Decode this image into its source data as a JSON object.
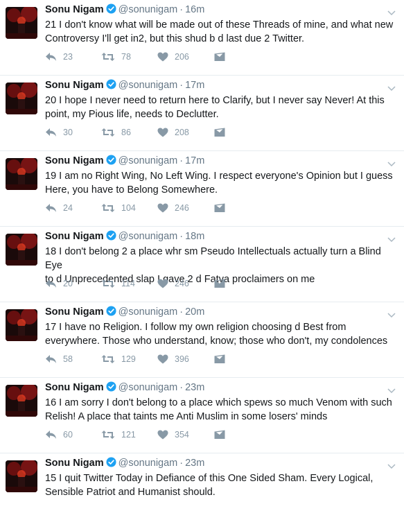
{
  "tweets": [
    {
      "name": "Sonu Nigam",
      "handle": "@sonunigam",
      "time": "16m",
      "line1": "21 I don't know what will be made out of these Threads of mine, and what new",
      "line2": "Controversy I'll get in2, but this shud b d last due 2 Twitter.",
      "replies": "23",
      "retweets": "78",
      "likes": "206"
    },
    {
      "name": "Sonu Nigam",
      "handle": "@sonunigam",
      "time": "17m",
      "line1": "20 I hope I never need to return here to Clarify, but I never say Never! At this",
      "line2": "point, my Pious life, needs to Declutter.",
      "replies": "30",
      "retweets": "86",
      "likes": "208"
    },
    {
      "name": "Sonu Nigam",
      "handle": "@sonunigam",
      "time": "17m",
      "line1": "19 I am no Right Wing, No Left Wing. I respect everyone's Opinion but I guess",
      "line2": "Here, you have to Belong Somewhere.",
      "replies": "24",
      "retweets": "104",
      "likes": "246"
    },
    {
      "name": "Sonu Nigam",
      "handle": "@sonunigam",
      "time": "18m",
      "line1": "18 I don't belong 2 a place whr sm Pseudo Intellectuals actually turn a Blind Eye",
      "line2": "to d Unprecedented slap I gave 2 d Fatva proclaimers on me",
      "replies": "20",
      "retweets": "114",
      "likes": "246"
    },
    {
      "name": "Sonu Nigam",
      "handle": "@sonunigam",
      "time": "20m",
      "line1": "17 I have no Religion. I follow my own religion choosing d Best from",
      "line2": "everywhere. Those who understand, know; those who don't, my condolences",
      "replies": "58",
      "retweets": "129",
      "likes": "396"
    },
    {
      "name": "Sonu Nigam",
      "handle": "@sonunigam",
      "time": "23m",
      "line1": "16 I am sorry I don't belong to a place which spews so much Venom with such",
      "line2": "Relish! A place that taints me Anti Muslim in some losers' minds",
      "replies": "60",
      "retweets": "121",
      "likes": "354"
    },
    {
      "name": "Sonu Nigam",
      "handle": "@sonunigam",
      "time": "23m",
      "line1": "15 I quit Twitter Today in Defiance of this One Sided Sham. Every Logical,",
      "line2": "Sensible Patriot and Humanist should.",
      "replies": "",
      "retweets": "",
      "likes": ""
    }
  ],
  "separator": "·",
  "icons": {
    "reply": "reply-icon",
    "retweet": "retweet-icon",
    "like": "heart-icon",
    "dm": "envelope-icon",
    "caret": "chevron-down-icon",
    "verified": "verified-badge-icon"
  },
  "colors": {
    "icon": "#8899a6",
    "verified": "#1da1f2",
    "border": "#e6ecf0",
    "muted": "#657786"
  }
}
